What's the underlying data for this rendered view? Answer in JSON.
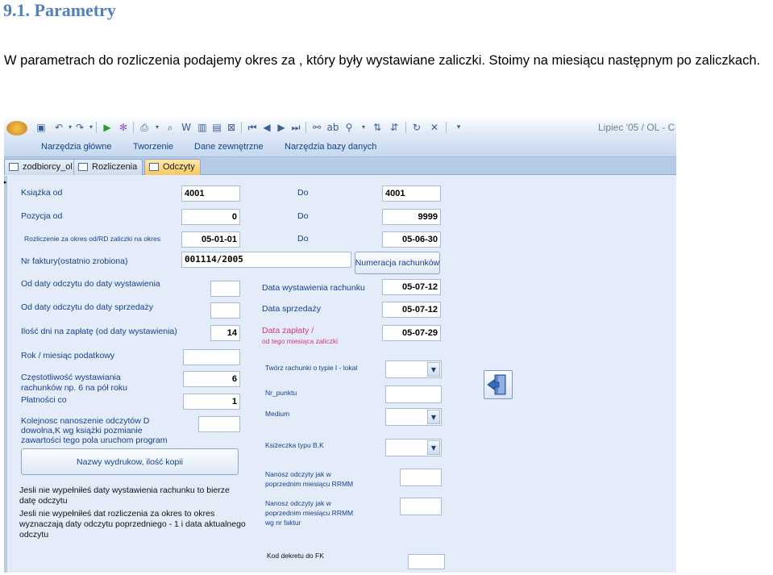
{
  "document": {
    "heading": "9.1. Parametry",
    "paragraph": "W parametrach do rozliczenia podajemy okres za , który były wystawiane zaliczki. Stoimy na miesiącu następnym po zaliczkach."
  },
  "app": {
    "title": "Lipiec '05 / OL - C",
    "ribbon_tabs": [
      "Narzędzia główne",
      "Tworzenie",
      "Dane zewnętrzne",
      "Narzędzia bazy danych"
    ],
    "object_tabs": [
      "zodbiorcy_ol",
      "Rozliczenia",
      "Odczyty"
    ],
    "active_tab": "Odczyty",
    "accent_color": "#15428b"
  },
  "form": {
    "ksiazka_od": {
      "label": "Książka od",
      "value": "4001"
    },
    "ksiazka_do": {
      "label": "Do",
      "value": "4001"
    },
    "pozycja_od": {
      "label": "Pozycja od",
      "value": "0"
    },
    "pozycja_do": {
      "label": "Do",
      "value": "9999"
    },
    "rozliczenie_od": {
      "label": "Rozliczenie za okres od/RD zaliczki na okres",
      "value": "05-01-01"
    },
    "rozliczenie_do": {
      "label": "Do",
      "value": "05-06-30"
    },
    "nr_faktury": {
      "label": "Nr faktury(ostatnio zrobiona)",
      "value": "001114/2005"
    },
    "numeracja_button": "Numeracja rachunków",
    "od_daty_wystawienia": {
      "label": "Od daty odczytu do daty wystawienia",
      "value": ""
    },
    "od_daty_sprzedazy": {
      "label": "Od daty odczytu do daty sprzedaży",
      "value": ""
    },
    "ilosc_dni": {
      "label": "Ilość dni na zapłatę (od daty wystawienia)",
      "value": "14"
    },
    "data_wystawienia": {
      "label": "Data wystawienia rachunku",
      "value": "05-07-12"
    },
    "data_sprzedazy": {
      "label": "Data sprzedaży",
      "value": "05-07-12"
    },
    "data_zaplaty": {
      "label_line1": "Data zapłaty   /",
      "label_line2": "od tego miesiąca zaliczki",
      "value": "05-07-29"
    },
    "rok_miesiac": {
      "label": "Rok / miesiąc podatkowy",
      "value": ""
    },
    "czestotliwosc": {
      "label_line1": "Częstotliwość wystawiania",
      "label_line2": "rachunków  np.  6 na pół roku",
      "value": "6"
    },
    "platnosci": {
      "label": "Płatności co",
      "value": "1"
    },
    "kolejnosc": {
      "label_line1": "Kolejnosc nanoszenie odczytów D",
      "label_line2": "dowolna,K wg książki pozmianie",
      "label_line3": "zawartości tego pola uruchom program",
      "value": ""
    },
    "nazwy_wydrukow_button": "Nazwy wydrukow, ilość kopii",
    "tworz_rachunki": {
      "label": "Twórz rachunki o typie I - lokal",
      "value": ""
    },
    "nr_punktu": {
      "label": "Nr_punktu",
      "value": ""
    },
    "medium": {
      "label": "Medium",
      "value": ""
    },
    "ksiazeczka": {
      "label": "Ksiżeczka typu B,K",
      "value": ""
    },
    "nanosz_rrmm": {
      "label_line1": "Nanosz odczyty jak w",
      "label_line2": "poprzednim miesiącu RRMM",
      "value": ""
    },
    "nanosz_rrmm_faktur": {
      "label_line1": "Nanosz odczyty jak w",
      "label_line2": "poprzednim miesiącu RRMM",
      "label_line3": "wg nr faktur",
      "value": ""
    },
    "note1_line1": "Jesli nie wypełniłeś daty wystawienia rachunku to bierze",
    "note1_line2": "datę odczytu",
    "note2_line1": "Jesli nie wypełniłeś dat rozliczenia za okres to okres",
    "note2_line2": "wyznaczają daty odczytu poprzedniego - 1 i data aktualnego",
    "note2_line3": "odczytu",
    "kod_dekretu": {
      "label": "Kod dekretu do FK",
      "value": ""
    }
  }
}
